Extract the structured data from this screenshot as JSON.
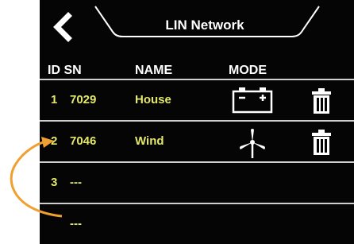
{
  "header": {
    "title": "LIN Network",
    "back_icon": "chevron-left-icon"
  },
  "columns": {
    "id_sn": "ID SN",
    "name": "NAME",
    "mode": "MODE"
  },
  "rows": [
    {
      "id": "1",
      "sn": "7029",
      "name": "House",
      "mode_icon": "battery-icon",
      "delete_icon": "trash-icon"
    },
    {
      "id": "2",
      "sn": "7046",
      "name": "Wind",
      "mode_icon": "wind-turbine-icon",
      "delete_icon": "trash-icon"
    },
    {
      "id": "3",
      "sn": "---",
      "name": "",
      "mode_icon": "",
      "delete_icon": ""
    },
    {
      "id": "",
      "sn": "---",
      "name": "",
      "mode_icon": "",
      "delete_icon": ""
    }
  ],
  "colors": {
    "screen_bg": "#050505",
    "text_primary": "#ffffff",
    "row_text": "#e3e86a",
    "divider": "#cfcfcf",
    "annotation_arrow": "#f0a030"
  }
}
